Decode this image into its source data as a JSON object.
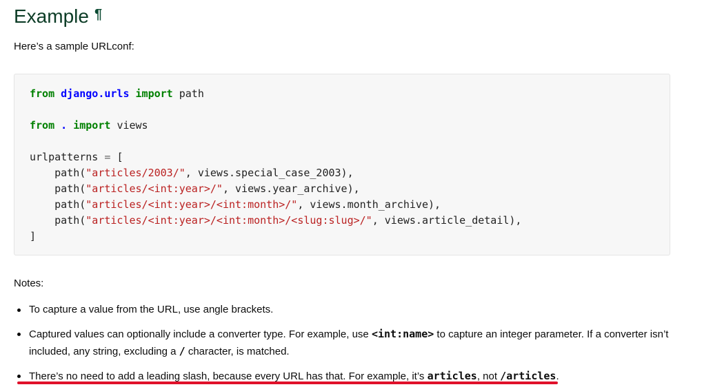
{
  "heading": {
    "title": "Example",
    "anchor_symbol": "¶"
  },
  "intro_text": "Here’s a sample URLconf:",
  "code": {
    "line1": {
      "kw1": "from",
      "module": "django.urls",
      "kw2": "import",
      "name": "path"
    },
    "line2": {
      "kw1": "from",
      "module": ".",
      "kw2": "import",
      "name": "views"
    },
    "line3": {
      "var": "urlpatterns",
      "op": "=",
      "open": "["
    },
    "paths": [
      {
        "fn": "path(",
        "str": "\"articles/2003/\"",
        "rest": ", views.special_case_2003),"
      },
      {
        "fn": "path(",
        "str": "\"articles/<int:year>/\"",
        "rest": ", views.year_archive),"
      },
      {
        "fn": "path(",
        "str": "\"articles/<int:year>/<int:month>/\"",
        "rest": ", views.month_archive),"
      },
      {
        "fn": "path(",
        "str": "\"articles/<int:year>/<int:month>/<slug:slug>/\"",
        "rest": ", views.article_detail),"
      }
    ],
    "close": "]"
  },
  "notes_label": "Notes:",
  "notes": [
    {
      "text": "To capture a value from the URL, use angle brackets."
    },
    {
      "before": "Captured values can optionally include a converter type. For example, use ",
      "code1": "<int:name>",
      "middle": " to capture an integer parameter. If a converter isn’t included, any string, excluding a ",
      "code2": "/",
      "after": " character, is matched."
    },
    {
      "before": "There’s no need to add a leading slash, because every URL has that. For example, it’s ",
      "code1": "articles",
      "middle": ", not ",
      "code2": "/articles",
      "after": "."
    }
  ],
  "colors": {
    "heading": "#0c3c26",
    "keyword": "#008000",
    "module": "#0000ff",
    "string": "#ba2121",
    "highlight_underline": "#e0112b",
    "code_background": "#f7f7f7"
  }
}
